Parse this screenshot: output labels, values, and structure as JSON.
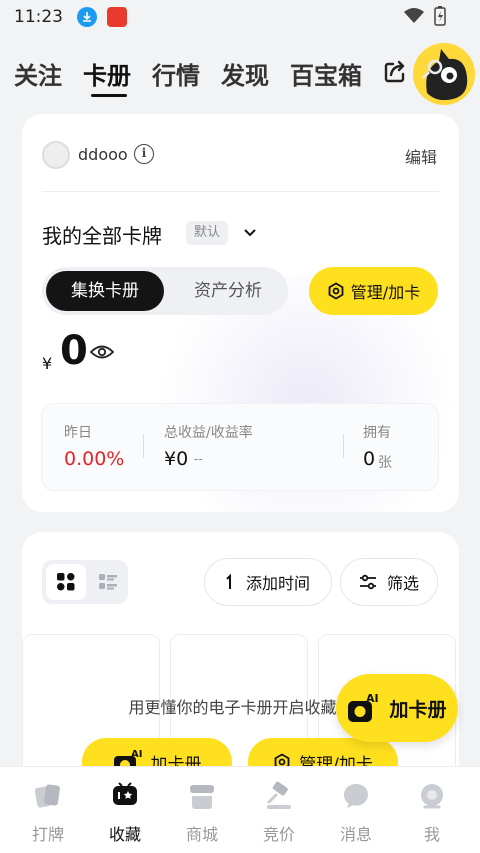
{
  "status_bar": {
    "time": "11:23"
  },
  "top_tabs": [
    {
      "label": "关注"
    },
    {
      "label": "卡册"
    },
    {
      "label": "行情"
    },
    {
      "label": "发现"
    },
    {
      "label": "百宝箱"
    }
  ],
  "active_tab": "卡册",
  "profile": {
    "username": "ddooo",
    "edit_label": "编辑"
  },
  "deck": {
    "title": "我的全部卡牌",
    "default_tag": "默认"
  },
  "segment": {
    "option_a": "集换卡册",
    "option_b": "资产分析"
  },
  "manage_button": "管理/加卡",
  "balance": {
    "currency": "¥",
    "amount": "0"
  },
  "stats": {
    "yesterday_label": "昨日",
    "yesterday_value": "0.00%",
    "total_label": "总收益/收益率",
    "total_value": "¥0",
    "total_rate": "--",
    "own_label": "拥有",
    "own_value": "0",
    "own_unit": "张"
  },
  "toolbar": {
    "sort_label": "添加时间",
    "filter_label": "筛选"
  },
  "empty_state": {
    "message": "用更懂你的电子卡册开启收藏之",
    "add_deck_button": "加卡册",
    "manage_button": "管理/加卡"
  },
  "fab": {
    "label": "加卡册",
    "badge": "AI"
  },
  "bottom_tabs": [
    {
      "label": "打牌",
      "icon": "cards-icon"
    },
    {
      "label": "收藏",
      "icon": "collection-icon"
    },
    {
      "label": "商城",
      "icon": "shop-icon"
    },
    {
      "label": "竞价",
      "icon": "auction-icon"
    },
    {
      "label": "消息",
      "icon": "message-icon"
    },
    {
      "label": "我",
      "icon": "profile-icon"
    }
  ],
  "colors": {
    "accent": "#ffe01f",
    "negative": "#e32626",
    "dark": "#141414"
  }
}
